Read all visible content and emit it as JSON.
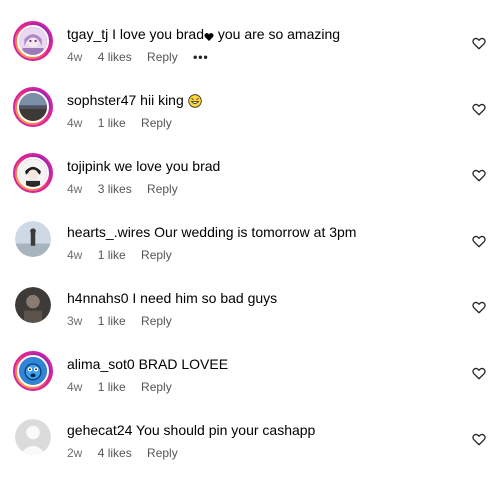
{
  "comments": [
    {
      "user": "tgay_tj",
      "text_before": "I love you brad",
      "text_after": " you are so amazing",
      "inline_icon": "black-heart-icon",
      "time": "4w",
      "likes": "4 likes",
      "reply": "Reply",
      "more": "•••",
      "avatar_icon": "anime-avatar-icon",
      "story_ring": true
    },
    {
      "user": "sophster47",
      "text_before": "hii king",
      "text_after": "",
      "inline_icon": "grinning-emoji-icon",
      "time": "4w",
      "likes": "1 like",
      "reply": "Reply",
      "avatar_icon": "landscape-avatar-icon",
      "story_ring": true
    },
    {
      "user": "tojipink",
      "text_before": "we love you brad",
      "text_after": "",
      "time": "4w",
      "likes": "3 likes",
      "reply": "Reply",
      "avatar_icon": "anime-boy-avatar-icon",
      "story_ring": true
    },
    {
      "user": "hearts_.wires",
      "text_before": "Our wedding is tomorrow at 3pm",
      "text_after": "",
      "time": "4w",
      "likes": "1 like",
      "reply": "Reply",
      "avatar_icon": "beach-avatar-icon",
      "story_ring": false
    },
    {
      "user": "h4nnahs0",
      "text_before": "I need him so bad guys",
      "text_after": "",
      "time": "3w",
      "likes": "1 like",
      "reply": "Reply",
      "avatar_icon": "dark-photo-avatar-icon",
      "story_ring": false
    },
    {
      "user": "alima_sot0",
      "text_before": "BRAD LOVEE",
      "text_after": "",
      "time": "4w",
      "likes": "1 like",
      "reply": "Reply",
      "avatar_icon": "blue-cartoon-avatar-icon",
      "story_ring": true
    },
    {
      "user": "gehecat24",
      "text_before": "You should pin your cashapp",
      "text_after": "",
      "time": "2w",
      "likes": "4 likes",
      "reply": "Reply",
      "avatar_icon": "default-user-avatar-icon",
      "story_ring": false
    }
  ]
}
